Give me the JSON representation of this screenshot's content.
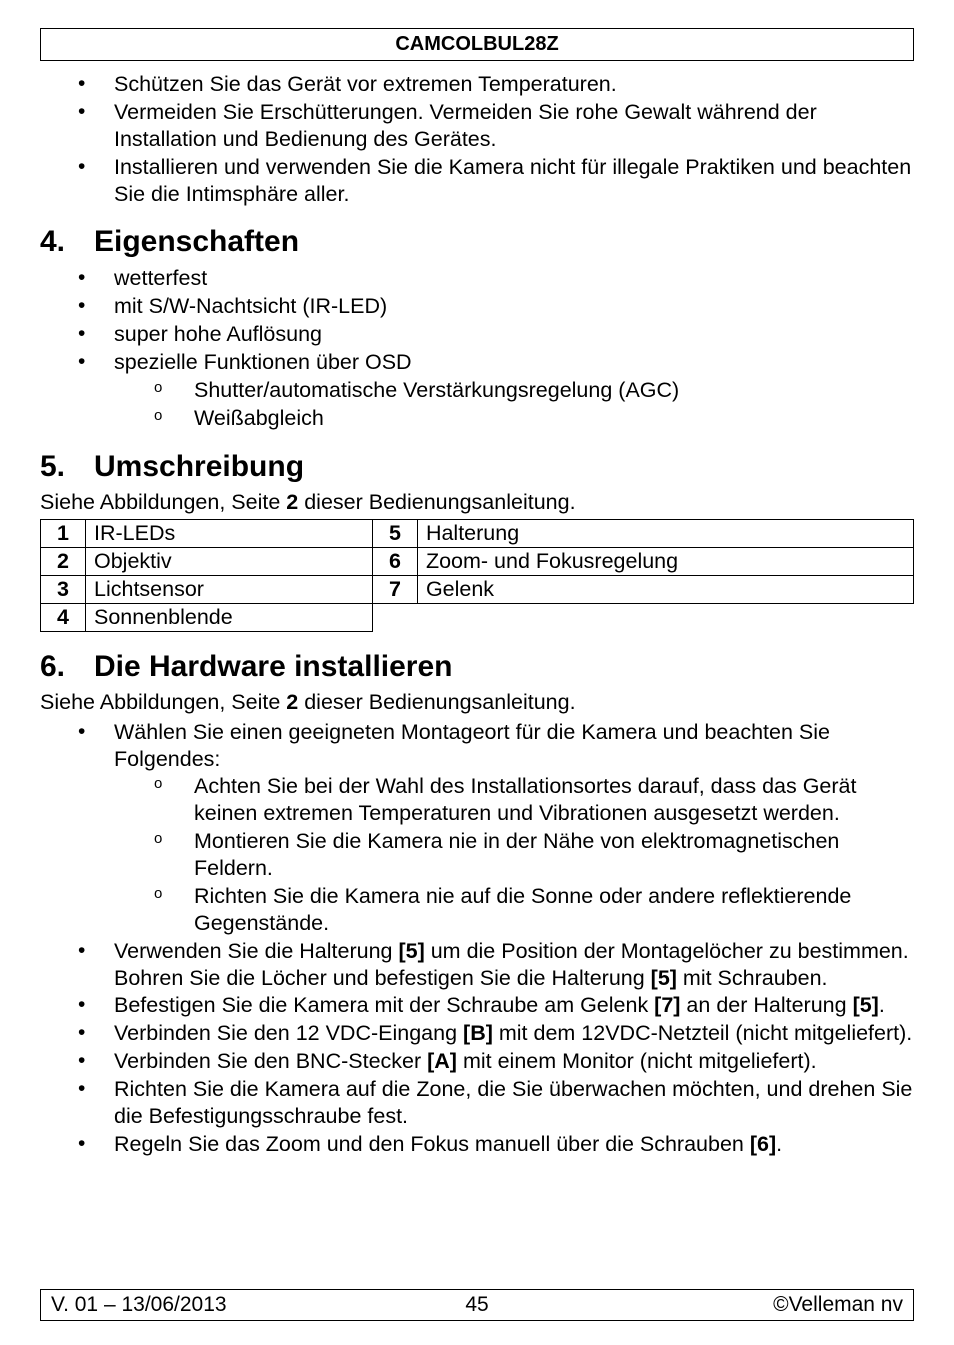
{
  "header": {
    "title": "CAMCOLBUL28Z"
  },
  "intro_bullets": [
    "Schützen Sie das Gerät vor extremen Temperaturen.",
    "Vermeiden Sie Erschütterungen. Vermeiden Sie rohe Gewalt während der Installation und Bedienung des Gerätes.",
    "Installieren und verwenden Sie die Kamera nicht für illegale Praktiken und beachten Sie die Intimsphäre aller."
  ],
  "sec4": {
    "num": "4.",
    "title": "Eigenschaften",
    "bullets": [
      "wetterfest",
      "mit S/W-Nachtsicht (IR-LED)",
      "super hohe Auflösung",
      "spezielle Funktionen über OSD"
    ],
    "sub": [
      "Shutter/automatische Verstärkungsregelung (AGC)",
      "Weißabgleich"
    ]
  },
  "sec5": {
    "num": "5.",
    "title": "Umschreibung",
    "intro_a": "Siehe Abbildungen, Seite ",
    "intro_b": "2",
    "intro_c": " dieser Bedienungsanleitung.",
    "rows": [
      {
        "ln": "1",
        "lt": "IR-LEDs",
        "rn": "5",
        "rt": "Halterung"
      },
      {
        "ln": "2",
        "lt": "Objektiv",
        "rn": "6",
        "rt": "Zoom- und Fokusregelung"
      },
      {
        "ln": "3",
        "lt": "Lichtsensor",
        "rn": "7",
        "rt": "Gelenk"
      },
      {
        "ln": "4",
        "lt": "Sonnenblende",
        "rn": "",
        "rt": ""
      }
    ]
  },
  "sec6": {
    "num": "6.",
    "title": "Die Hardware installieren",
    "intro_a": "Siehe Abbildungen, Seite ",
    "intro_b": "2",
    "intro_c": " dieser Bedienungsanleitung.",
    "b1": "Wählen Sie einen geeigneten Montageort für die Kamera und beachten Sie Folgendes:",
    "sub": [
      "Achten Sie bei der Wahl des Installationsortes darauf, dass das Gerät keinen extremen Temperaturen und Vibrationen ausgesetzt werden.",
      "Montieren Sie die Kamera nie in der Nähe von elektromagnetischen Feldern.",
      "Richten Sie die Kamera nie auf die Sonne oder andere reflektierende Gegenstände."
    ],
    "b2": {
      "a": "Verwenden Sie die Halterung ",
      "b": "[5]",
      "c": " um die Position der Montagelöcher zu bestimmen. Bohren Sie die Löcher und befestigen Sie die Halterung ",
      "d": "[5]",
      "e": " mit Schrauben."
    },
    "b3": {
      "a": "Befestigen Sie die Kamera mit der Schraube am Gelenk ",
      "b": "[7]",
      "c": " an der Halterung ",
      "d": "[5]",
      "e": "."
    },
    "b4": {
      "a": "Verbinden Sie den 12 VDC-Eingang ",
      "b": "[B]",
      "c": " mit dem 12VDC-Netzteil (nicht mitgeliefert)."
    },
    "b5": {
      "a": "Verbinden Sie den BNC-Stecker ",
      "b": "[A]",
      "c": " mit einem Monitor (nicht mitgeliefert)."
    },
    "b6": "Richten Sie die Kamera auf die Zone, die Sie überwachen möchten, und drehen Sie die Befestigungsschraube fest.",
    "b7": {
      "a": "Regeln Sie das Zoom und den Fokus manuell über die Schrauben ",
      "b": "[6]",
      "c": "."
    }
  },
  "footer": {
    "left": "V. 01 – 13/06/2013",
    "center": "45",
    "right": "©Velleman nv"
  }
}
